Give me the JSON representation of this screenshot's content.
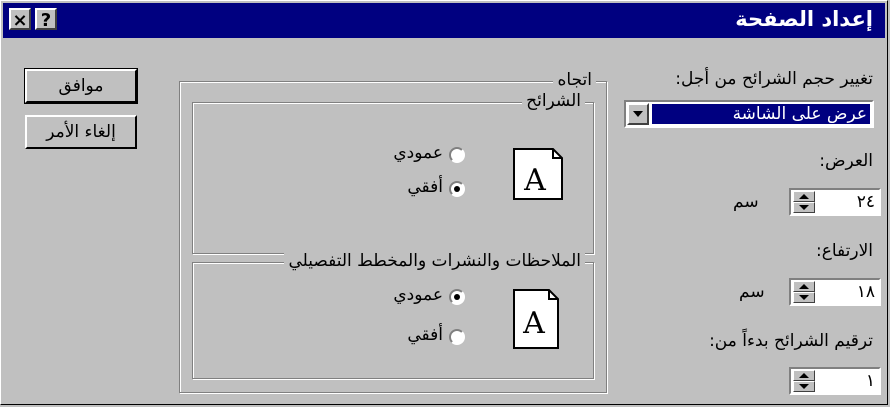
{
  "window": {
    "title": "إعداد الصفحة",
    "help_glyph": "?",
    "close_glyph": "×"
  },
  "size_for": {
    "label": "تغيير حجم الشرائح من أجل:",
    "value": "عرض على الشاشة"
  },
  "width": {
    "label": "العرض:",
    "value": "٢٤",
    "unit": "سم"
  },
  "height": {
    "label": "الارتفاع:",
    "value": "١٨",
    "unit": "سم"
  },
  "numbering": {
    "label": "ترقيم الشرائح بدءاً من:",
    "value": "١"
  },
  "orientation": {
    "title": "اتجاه",
    "slides": {
      "title": "الشرائح",
      "portrait": "عمودي",
      "landscape": "أفقي",
      "selected": "landscape"
    },
    "notes": {
      "title": "الملاحظات والنشرات والمخطط التفصيلي",
      "portrait": "عمودي",
      "landscape": "أفقي",
      "selected": "portrait"
    }
  },
  "buttons": {
    "ok": "موافق",
    "cancel": "إلغاء الأمر"
  },
  "icons": {
    "doc": "A"
  },
  "colors": {
    "titlebar": "#000080",
    "face": "#c0c0c0",
    "selection": "#000080"
  }
}
